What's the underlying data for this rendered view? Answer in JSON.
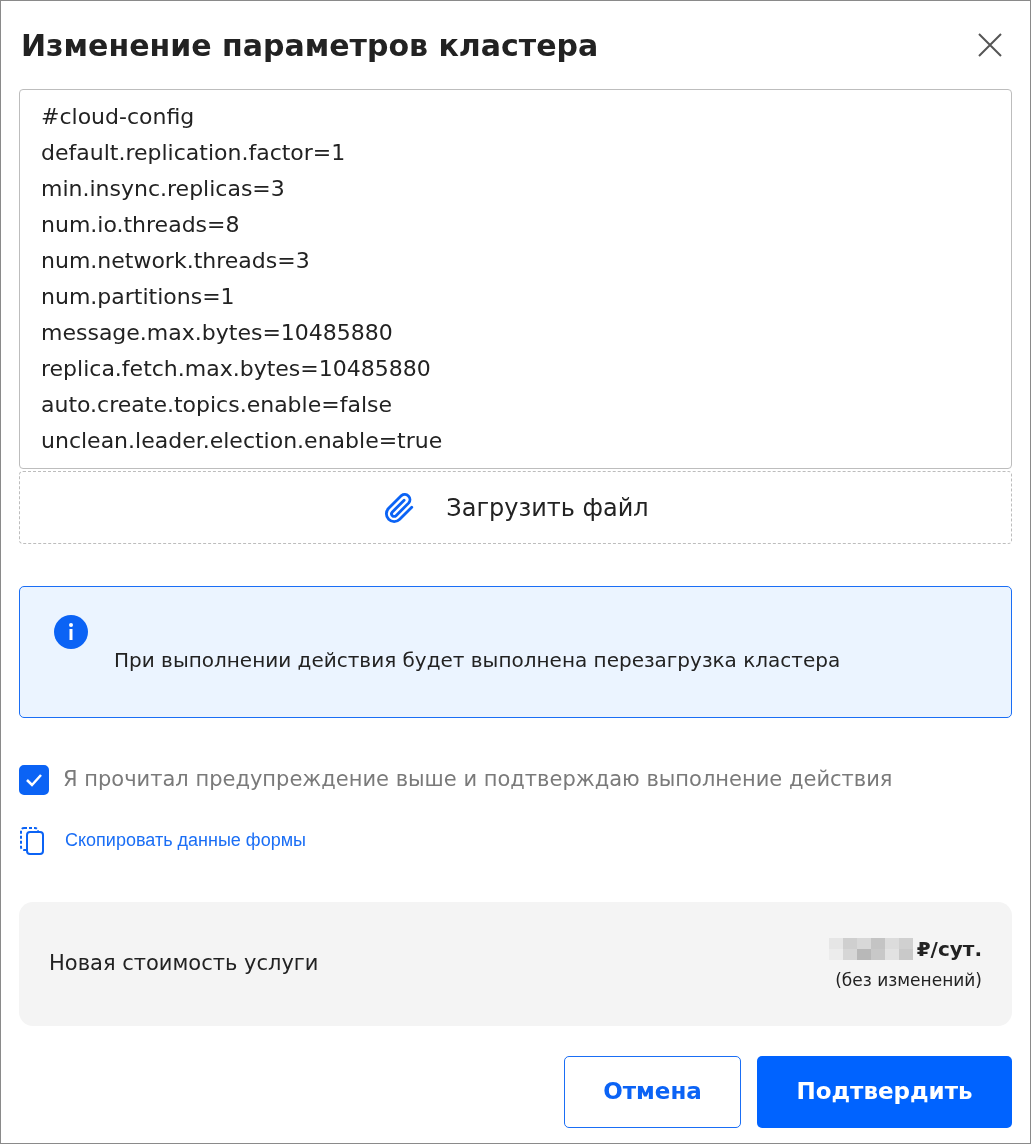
{
  "dialog": {
    "title": "Изменение параметров кластера"
  },
  "config": {
    "lines": [
      "#cloud-config",
      "default.replication.factor=1",
      "min.insync.replicas=3",
      "num.io.threads=8",
      "num.network.threads=3",
      "num.partitions=1",
      "message.max.bytes=10485880",
      "replica.fetch.max.bytes=10485880",
      "auto.create.topics.enable=false",
      "unclean.leader.election.enable=true"
    ]
  },
  "upload": {
    "label": "Загрузить файл"
  },
  "info": {
    "text": "При выполнении действия будет выполнена перезагрузка кластера"
  },
  "confirm_checkbox": {
    "label": "Я прочитал предупреждение выше и подтверждаю выполнение действия",
    "checked": true
  },
  "copy_link": {
    "label": "Скопировать данные формы"
  },
  "cost": {
    "label": "Новая стоимость услуги",
    "unit": "₽/сут.",
    "note": "(без изменений)"
  },
  "buttons": [
    {
      "kind": "secondary",
      "label": "Отмена"
    },
    {
      "kind": "primary",
      "label": "Подтвердить"
    }
  ]
}
